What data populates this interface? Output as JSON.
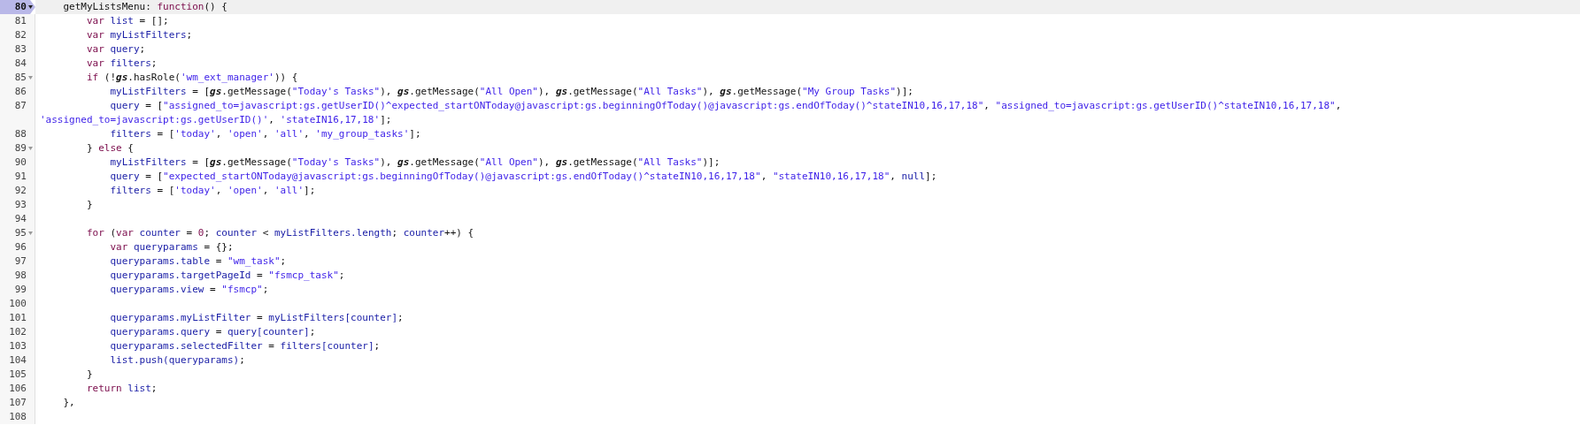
{
  "editor": {
    "lines": [
      {
        "number": "80",
        "current": true,
        "foldable": true,
        "tokens": [
          {
            "kind": "plain",
            "text": "    getMyListsMenu: "
          },
          {
            "kind": "kw",
            "text": "function"
          },
          {
            "kind": "plain",
            "text": "() {"
          }
        ]
      },
      {
        "number": "81",
        "current": false,
        "foldable": false,
        "tokens": [
          {
            "kind": "kw",
            "text": "        var"
          },
          {
            "kind": "var",
            "text": " list"
          },
          {
            "kind": "plain",
            "text": " = [];"
          }
        ]
      },
      {
        "number": "82",
        "current": false,
        "foldable": false,
        "tokens": [
          {
            "kind": "kw",
            "text": "        var"
          },
          {
            "kind": "var",
            "text": " myListFilters"
          },
          {
            "kind": "plain",
            "text": ";"
          }
        ]
      },
      {
        "number": "83",
        "current": false,
        "foldable": false,
        "tokens": [
          {
            "kind": "kw",
            "text": "        var"
          },
          {
            "kind": "var",
            "text": " query"
          },
          {
            "kind": "plain",
            "text": ";"
          }
        ]
      },
      {
        "number": "84",
        "current": false,
        "foldable": false,
        "tokens": [
          {
            "kind": "kw",
            "text": "        var"
          },
          {
            "kind": "var",
            "text": " filters"
          },
          {
            "kind": "plain",
            "text": ";"
          }
        ]
      },
      {
        "number": "85",
        "current": false,
        "foldable": true,
        "tokens": [
          {
            "kind": "kw",
            "text": "        if"
          },
          {
            "kind": "plain",
            "text": " (!"
          },
          {
            "kind": "global",
            "text": "gs"
          },
          {
            "kind": "plain",
            "text": ".hasRole("
          },
          {
            "kind": "str",
            "text": "'wm_ext_manager'"
          },
          {
            "kind": "plain",
            "text": ")) {"
          }
        ]
      },
      {
        "number": "86",
        "current": false,
        "foldable": false,
        "tokens": [
          {
            "kind": "var",
            "text": "            myListFilters"
          },
          {
            "kind": "plain",
            "text": " = ["
          },
          {
            "kind": "global",
            "text": "gs"
          },
          {
            "kind": "plain",
            "text": ".getMessage("
          },
          {
            "kind": "str",
            "text": "\"Today's Tasks\""
          },
          {
            "kind": "plain",
            "text": "), "
          },
          {
            "kind": "global",
            "text": "gs"
          },
          {
            "kind": "plain",
            "text": ".getMessage("
          },
          {
            "kind": "str",
            "text": "\"All Open\""
          },
          {
            "kind": "plain",
            "text": "), "
          },
          {
            "kind": "global",
            "text": "gs"
          },
          {
            "kind": "plain",
            "text": ".getMessage("
          },
          {
            "kind": "str",
            "text": "\"All Tasks\""
          },
          {
            "kind": "plain",
            "text": "), "
          },
          {
            "kind": "global",
            "text": "gs"
          },
          {
            "kind": "plain",
            "text": ".getMessage("
          },
          {
            "kind": "str",
            "text": "\"My Group Tasks\""
          },
          {
            "kind": "plain",
            "text": ")];"
          }
        ]
      },
      {
        "number": "87",
        "current": false,
        "foldable": false,
        "tokens": [
          {
            "kind": "var",
            "text": "            query"
          },
          {
            "kind": "plain",
            "text": " = ["
          },
          {
            "kind": "str",
            "text": "\"assigned_to=javascript:gs.getUserID()^expected_startONToday@javascript:gs.beginningOfToday()@javascript:gs.endOfToday()^stateIN10,16,17,18\""
          },
          {
            "kind": "plain",
            "text": ", "
          },
          {
            "kind": "str",
            "text": "\"assigned_to=javascript:gs.getUserID()^stateIN10,16,17,18\""
          },
          {
            "kind": "plain",
            "text": ", "
          },
          {
            "kind": "str",
            "text": "'assigned_to=javascript:gs.getUserID()'"
          },
          {
            "kind": "plain",
            "text": ", "
          },
          {
            "kind": "str",
            "text": "'stateIN16,17,18'"
          },
          {
            "kind": "plain",
            "text": "];"
          }
        ]
      },
      {
        "number": "88",
        "current": false,
        "foldable": false,
        "tokens": [
          {
            "kind": "var",
            "text": "            filters"
          },
          {
            "kind": "plain",
            "text": " = ["
          },
          {
            "kind": "str",
            "text": "'today'"
          },
          {
            "kind": "plain",
            "text": ", "
          },
          {
            "kind": "str",
            "text": "'open'"
          },
          {
            "kind": "plain",
            "text": ", "
          },
          {
            "kind": "str",
            "text": "'all'"
          },
          {
            "kind": "plain",
            "text": ", "
          },
          {
            "kind": "str",
            "text": "'my_group_tasks'"
          },
          {
            "kind": "plain",
            "text": "];"
          }
        ]
      },
      {
        "number": "89",
        "current": false,
        "foldable": true,
        "tokens": [
          {
            "kind": "plain",
            "text": "        } "
          },
          {
            "kind": "kw",
            "text": "else"
          },
          {
            "kind": "plain",
            "text": " {"
          }
        ]
      },
      {
        "number": "90",
        "current": false,
        "foldable": false,
        "tokens": [
          {
            "kind": "var",
            "text": "            myListFilters"
          },
          {
            "kind": "plain",
            "text": " = ["
          },
          {
            "kind": "global",
            "text": "gs"
          },
          {
            "kind": "plain",
            "text": ".getMessage("
          },
          {
            "kind": "str",
            "text": "\"Today's Tasks\""
          },
          {
            "kind": "plain",
            "text": "), "
          },
          {
            "kind": "global",
            "text": "gs"
          },
          {
            "kind": "plain",
            "text": ".getMessage("
          },
          {
            "kind": "str",
            "text": "\"All Open\""
          },
          {
            "kind": "plain",
            "text": "), "
          },
          {
            "kind": "global",
            "text": "gs"
          },
          {
            "kind": "plain",
            "text": ".getMessage("
          },
          {
            "kind": "str",
            "text": "\"All Tasks\""
          },
          {
            "kind": "plain",
            "text": ")];"
          }
        ]
      },
      {
        "number": "91",
        "current": false,
        "foldable": false,
        "tokens": [
          {
            "kind": "var",
            "text": "            query"
          },
          {
            "kind": "plain",
            "text": " = ["
          },
          {
            "kind": "str",
            "text": "\"expected_startONToday@javascript:gs.beginningOfToday()@javascript:gs.endOfToday()^stateIN10,16,17,18\""
          },
          {
            "kind": "plain",
            "text": ", "
          },
          {
            "kind": "str",
            "text": "\"stateIN10,16,17,18\""
          },
          {
            "kind": "plain",
            "text": ", "
          },
          {
            "kind": "var",
            "text": "null"
          },
          {
            "kind": "plain",
            "text": "];"
          }
        ]
      },
      {
        "number": "92",
        "current": false,
        "foldable": false,
        "tokens": [
          {
            "kind": "var",
            "text": "            filters"
          },
          {
            "kind": "plain",
            "text": " = ["
          },
          {
            "kind": "str",
            "text": "'today'"
          },
          {
            "kind": "plain",
            "text": ", "
          },
          {
            "kind": "str",
            "text": "'open'"
          },
          {
            "kind": "plain",
            "text": ", "
          },
          {
            "kind": "str",
            "text": "'all'"
          },
          {
            "kind": "plain",
            "text": "];"
          }
        ]
      },
      {
        "number": "93",
        "current": false,
        "foldable": false,
        "tokens": [
          {
            "kind": "plain",
            "text": "        }"
          }
        ]
      },
      {
        "number": "94",
        "current": false,
        "foldable": false
      },
      {
        "number": "95",
        "current": false,
        "foldable": true,
        "tokens": [
          {
            "kind": "kw",
            "text": "        for"
          },
          {
            "kind": "plain",
            "text": " ("
          },
          {
            "kind": "kw",
            "text": "var"
          },
          {
            "kind": "var",
            "text": " counter"
          },
          {
            "kind": "plain",
            "text": " = "
          },
          {
            "kind": "num",
            "text": "0"
          },
          {
            "kind": "plain",
            "text": "; "
          },
          {
            "kind": "var",
            "text": "counter"
          },
          {
            "kind": "plain",
            "text": " < "
          },
          {
            "kind": "var",
            "text": "myListFilters.length"
          },
          {
            "kind": "plain",
            "text": "; "
          },
          {
            "kind": "var",
            "text": "counter"
          },
          {
            "kind": "plain",
            "text": "++) {"
          }
        ]
      },
      {
        "number": "96",
        "current": false,
        "foldable": false,
        "tokens": [
          {
            "kind": "kw",
            "text": "            var"
          },
          {
            "kind": "var",
            "text": " queryparams"
          },
          {
            "kind": "plain",
            "text": " = {};"
          }
        ]
      },
      {
        "number": "97",
        "current": false,
        "foldable": false,
        "tokens": [
          {
            "kind": "var",
            "text": "            queryparams.table"
          },
          {
            "kind": "plain",
            "text": " = "
          },
          {
            "kind": "str",
            "text": "\"wm_task\""
          },
          {
            "kind": "plain",
            "text": ";"
          }
        ]
      },
      {
        "number": "98",
        "current": false,
        "foldable": false,
        "tokens": [
          {
            "kind": "var",
            "text": "            queryparams.targetPageId"
          },
          {
            "kind": "plain",
            "text": " = "
          },
          {
            "kind": "str",
            "text": "\"fsmcp_task\""
          },
          {
            "kind": "plain",
            "text": ";"
          }
        ]
      },
      {
        "number": "99",
        "current": false,
        "foldable": false,
        "tokens": [
          {
            "kind": "var",
            "text": "            queryparams.view"
          },
          {
            "kind": "plain",
            "text": " = "
          },
          {
            "kind": "str",
            "text": "\"fsmcp\""
          },
          {
            "kind": "plain",
            "text": ";"
          }
        ]
      },
      {
        "number": "100",
        "current": false,
        "foldable": false
      },
      {
        "number": "101",
        "current": false,
        "foldable": false,
        "tokens": [
          {
            "kind": "var",
            "text": "            queryparams.myListFilter"
          },
          {
            "kind": "plain",
            "text": " = "
          },
          {
            "kind": "var",
            "text": "myListFilters[counter]"
          },
          {
            "kind": "plain",
            "text": ";"
          }
        ]
      },
      {
        "number": "102",
        "current": false,
        "foldable": false,
        "tokens": [
          {
            "kind": "var",
            "text": "            queryparams.query"
          },
          {
            "kind": "plain",
            "text": " = "
          },
          {
            "kind": "var",
            "text": "query[counter]"
          },
          {
            "kind": "plain",
            "text": ";"
          }
        ]
      },
      {
        "number": "103",
        "current": false,
        "foldable": false,
        "tokens": [
          {
            "kind": "var",
            "text": "            queryparams.selectedFilter"
          },
          {
            "kind": "plain",
            "text": " = "
          },
          {
            "kind": "var",
            "text": "filters[counter]"
          },
          {
            "kind": "plain",
            "text": ";"
          }
        ]
      },
      {
        "number": "104",
        "current": false,
        "foldable": false,
        "tokens": [
          {
            "kind": "var",
            "text": "            list.push(queryparams)"
          },
          {
            "kind": "plain",
            "text": ";"
          }
        ]
      },
      {
        "number": "105",
        "current": false,
        "foldable": false,
        "tokens": [
          {
            "kind": "plain",
            "text": "        }"
          }
        ]
      },
      {
        "number": "106",
        "current": false,
        "foldable": false,
        "tokens": [
          {
            "kind": "kw",
            "text": "        return"
          },
          {
            "kind": "var",
            "text": " list"
          },
          {
            "kind": "plain",
            "text": ";"
          }
        ]
      },
      {
        "number": "107",
        "current": false,
        "foldable": false,
        "tokens": [
          {
            "kind": "plain",
            "text": "    },"
          }
        ]
      },
      {
        "number": "108",
        "current": false,
        "foldable": false
      }
    ]
  }
}
